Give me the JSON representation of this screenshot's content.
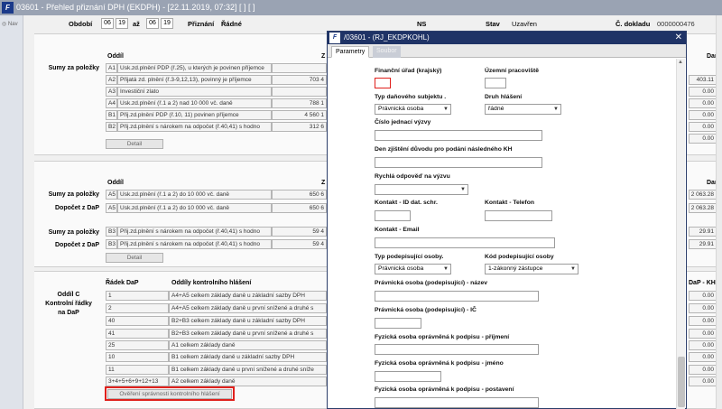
{
  "app": {
    "title": "03601 - Přehled přiznání DPH (EKDPH) - [22.11.2019, 07:32]  [ ]  [ ]",
    "nav_label": "Nav"
  },
  "header": {
    "obdobi_label": "Období",
    "from_month": "06",
    "from_year": "19",
    "az_label": "až",
    "to_month": "06",
    "to_year": "19",
    "priznani_label": "Přiznání",
    "radne_value": "Řádné",
    "ns_label": "NS",
    "stav_label": "Stav",
    "stav_value": "Uzavřen",
    "cdokladu_label": "Č. dokladu",
    "cdokladu_value": "0000000476"
  },
  "panel1": {
    "section_label": "Sumy za položky",
    "col_oddil": "Oddíl",
    "col_z": "Z",
    "rows": [
      {
        "code": "A1",
        "text": "Usk.zd.plnění PDP (ř.25), u kterých je povinen příjemce",
        "value": ""
      },
      {
        "code": "A2",
        "text": "Přijatá zd. plnění (ř.3-9,12,13), povinný je příjemce",
        "value": "703 4"
      },
      {
        "code": "A3",
        "text": "Investiční zlato",
        "value": ""
      },
      {
        "code": "A4",
        "text": "Usk.zd.plnění (ř.1 a 2) nad 10 000 vč. daně",
        "value": "788 1"
      },
      {
        "code": "B1",
        "text": "Přij.zd.plnění PDP (ř.10, 11) povinen příjemce",
        "value": "4 560 1"
      },
      {
        "code": "B2",
        "text": "Přij.zd.plnění s nárokem na odpočet (ř.40,41) s hodno",
        "value": "312 6"
      }
    ],
    "detail_button": "Detail",
    "right_values": [
      "403.11",
      "0.00",
      "0.00",
      "0.00",
      "0.00",
      "0.00"
    ],
    "right_header": "Daň"
  },
  "panel2": {
    "col_oddil": "Oddíl",
    "col_z": "Z",
    "right_header": "Daň",
    "groups": [
      {
        "label": "Sumy za položky",
        "code": "A5",
        "text": "Usk.zd.plnění (ř.1 a 2) do 10 000 vč. daně",
        "value": "650 6",
        "right": "2 063.28"
      },
      {
        "label": "Dopočet z DaP",
        "code": "A5",
        "text": "Usk.zd.plnění (ř.1 a 2) do 10 000 vč. daně",
        "value": "650 6",
        "right": "2 063.28"
      },
      {
        "label": "Sumy za položky",
        "code": "B3",
        "text": "Přij.zd.plnění s nárokem na odpočet (ř.40,41) s hodno",
        "value": "59 4",
        "right": "29.91"
      },
      {
        "label": "Dopočet z DaP",
        "code": "B3",
        "text": "Přij.zd.plnění s nárokem na odpočet (ř.40,41) s hodno",
        "value": "59 4",
        "right": "29.91"
      }
    ],
    "detail_button": "Detail"
  },
  "panel3": {
    "section_label_1": "Oddíl C",
    "section_label_2": "Kontrolní řádky",
    "section_label_3": "na DaP",
    "col_radek": "Řádek DaP",
    "col_oddily": "Oddíly kontrolního hlášení",
    "col_right": "DaP - KH",
    "rows": [
      {
        "radek": "1",
        "text": "A4+A5 celkem základy daně u základní sazby DPH",
        "right": "0.00"
      },
      {
        "radek": "2",
        "text": "A4+A5 celkem základy daně u první snížené a druhé s",
        "right": "0.00"
      },
      {
        "radek": "40",
        "text": "B2+B3 celkem základy daně u základní sazby DPH",
        "right": "0.00"
      },
      {
        "radek": "41",
        "text": "B2+B3 celkem základy daně u první snížené a druhé s",
        "right": "0.00"
      },
      {
        "radek": "25",
        "text": "A1 celkem základy daně",
        "right": "0.00"
      },
      {
        "radek": "10",
        "text": "B1 celkem základy daně u základní sazby DPH",
        "right": "0.00"
      },
      {
        "radek": "11",
        "text": "B1 celkem základy daně u první snížené a druhé sníže",
        "right": "0.00"
      },
      {
        "radek": "3+4+5+6+9+12+13",
        "text": "A2 celkem základy daně",
        "right": "0.00"
      }
    ],
    "verify_button": "Ověření správnosti kontrolního hlášení"
  },
  "dialog": {
    "title": "/03601 - (RJ_EKDPKOHL)",
    "close": "✕",
    "tabs": [
      "Parametry",
      "Soubor"
    ],
    "fields": {
      "financni_urad": "Finanční úřad (krajský)",
      "uzemni_pracoviste": "Územní pracoviště",
      "typ_subjektu": "Typ daňového subjektu .",
      "typ_subjektu_value": "Právnická osoba",
      "druh_hlaseni": "Druh hlášení",
      "druh_hlaseni_value": "řádné",
      "cislo_jednaci": "Číslo jednací výzvy",
      "den_zjisteni": "Den zjištění důvodu pro podání následného KH",
      "rychla_odpoved": "Rychlá odpověď na výzvu",
      "kontakt_id": "Kontakt - ID dat. schr.",
      "kontakt_telefon": "Kontakt - Telefon",
      "kontakt_email": "Kontakt - Email",
      "typ_podepisujici": "Typ podepisující osoby.",
      "typ_podepisujici_value": "Právnická osoba",
      "kod_podepisujici": "Kód podepisující osoby",
      "kod_podepisujici_value": "1-zákonný zástupce",
      "po_nazev": "Právnická osoba (podepisující) - název",
      "po_ic": "Právnická osoba (podepisující) - IČ",
      "fo_prijmeni": "Fyzická osoba oprávněná k podpisu - příjmení",
      "fo_jmeno": "Fyzická osoba oprávněná k podpisu - jméno",
      "fo_postaveni": "Fyzická osoba oprávněná k podpisu - postavení"
    }
  },
  "colors": {
    "titlebar": "#9aa3b3",
    "dialog_titlebar": "#1f3366",
    "highlight_red": "#e0201c",
    "help_icon_blue": "#1e4fa3"
  }
}
